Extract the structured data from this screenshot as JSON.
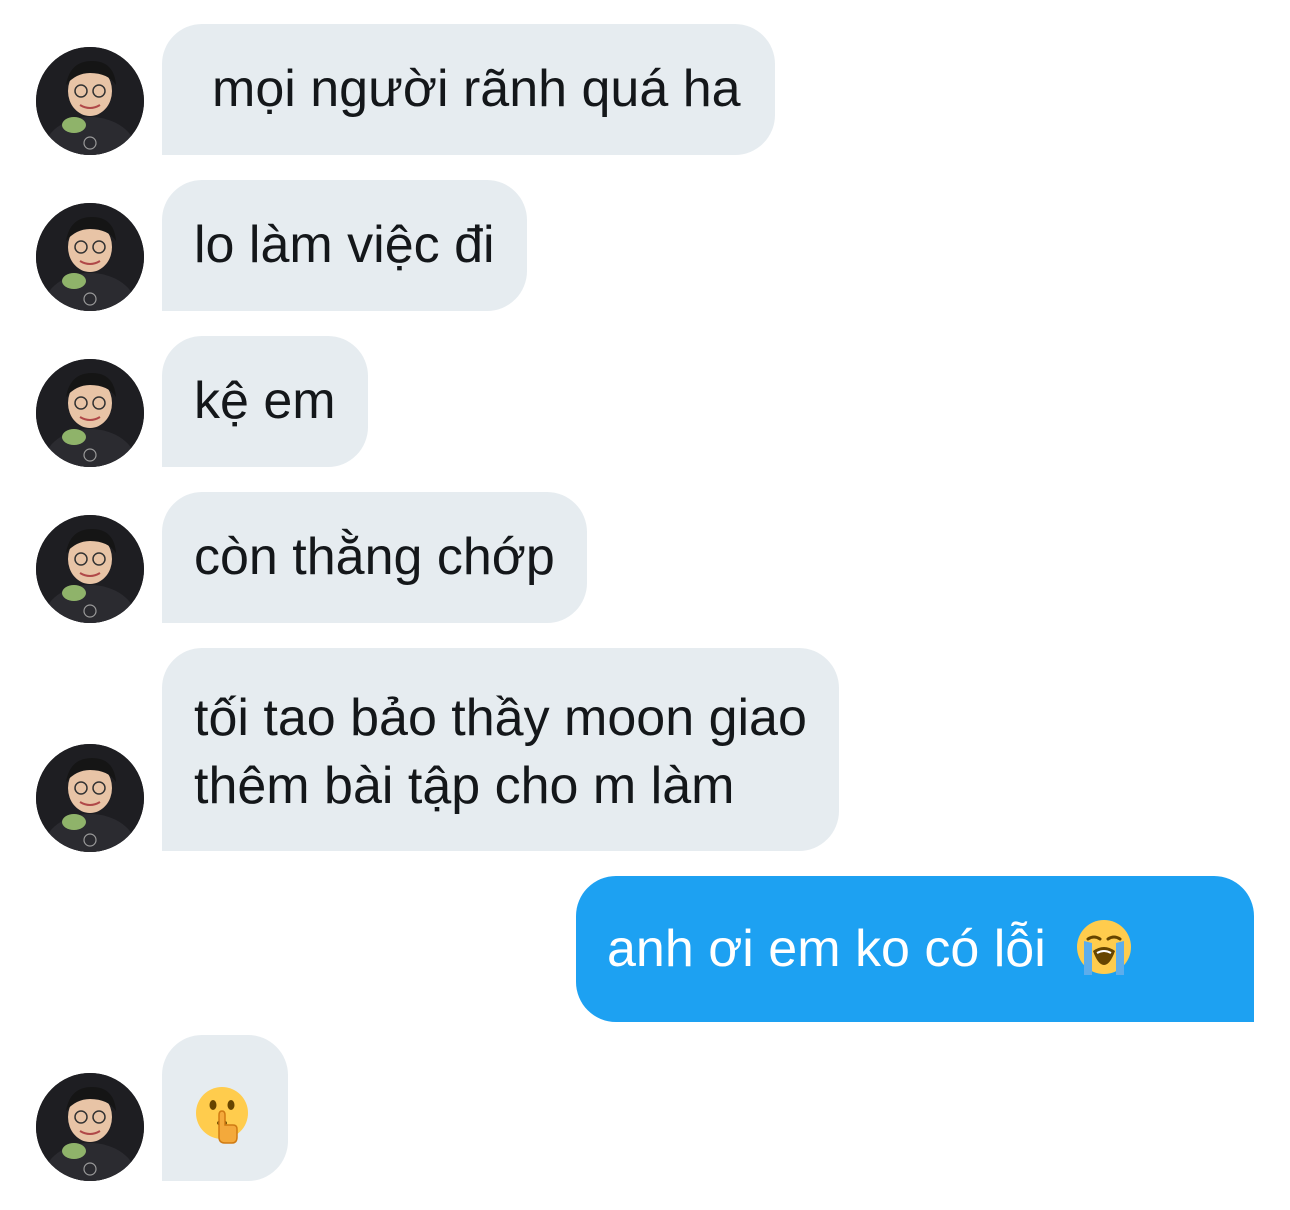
{
  "conversation": {
    "messages": [
      {
        "direction": "incoming",
        "text": "mọi người rãnh quá ha"
      },
      {
        "direction": "incoming",
        "text": "lo làm việc đi"
      },
      {
        "direction": "incoming",
        "text": "kệ em"
      },
      {
        "direction": "incoming",
        "text": "còn thằng chớp"
      },
      {
        "direction": "incoming",
        "lines": [
          "tối tao bảo thầy moon giao",
          "thêm bài tập cho m làm"
        ]
      },
      {
        "direction": "outgoing",
        "text": "anh ơi em ko có lỗi",
        "emoji": "loudly-crying-face-emoji"
      },
      {
        "direction": "incoming",
        "emoji": "shushing-face-emoji"
      }
    ]
  },
  "colors": {
    "incoming_bubble": "#e6ecf0",
    "outgoing_bubble": "#1da1f2",
    "incoming_text": "#14171a",
    "outgoing_text": "#ffffff"
  },
  "icons": {
    "avatar": "user-avatar-photo",
    "crying_emoji": "loudly-crying-face-emoji",
    "shush_emoji": "shushing-face-emoji"
  }
}
